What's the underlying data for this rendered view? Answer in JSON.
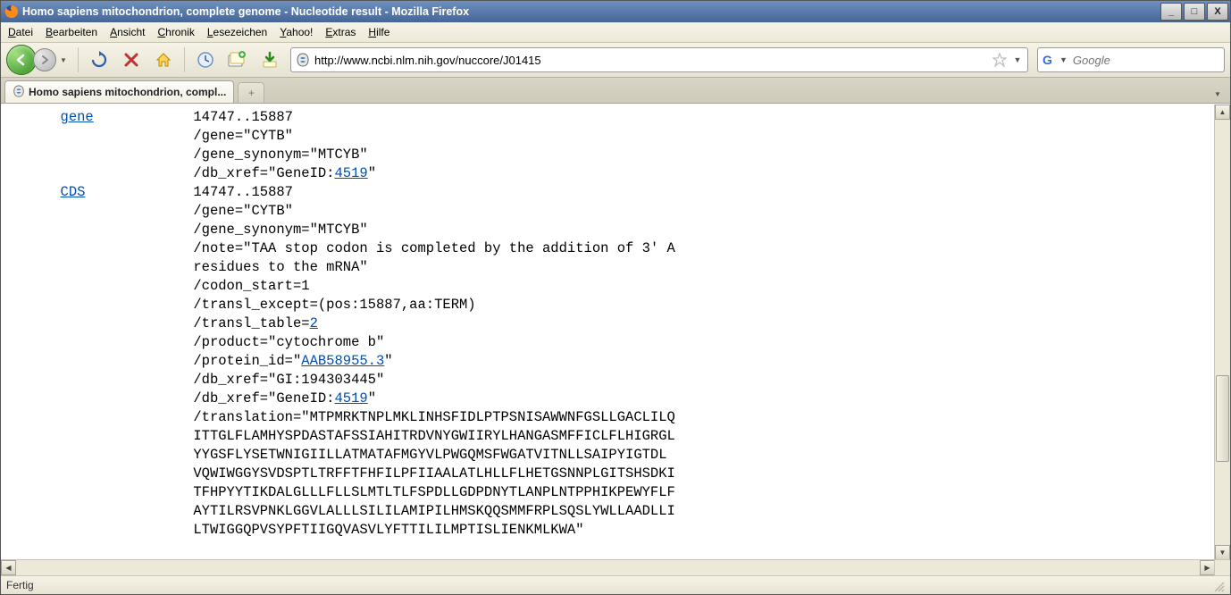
{
  "window": {
    "title": "Homo sapiens mitochondrion, complete genome - Nucleotide result - Mozilla Firefox"
  },
  "menu": {
    "items": [
      "Datei",
      "Bearbeiten",
      "Ansicht",
      "Chronik",
      "Lesezeichen",
      "Yahoo!",
      "Extras",
      "Hilfe"
    ]
  },
  "toolbar": {
    "url": "http://www.ncbi.nlm.nih.gov/nuccore/J01415",
    "search_placeholder": "Google"
  },
  "tabs": {
    "active": "Homo sapiens mitochondrion, compl..."
  },
  "status": {
    "text": "Fertig"
  },
  "content": {
    "lead_spaces": "     ",
    "data_spaces": "            ",
    "gene_key": "gene",
    "cds_key": "CDS",
    "gene": {
      "loc": "14747..15887",
      "q_gene": "/gene=\"CYTB\"",
      "q_syn": "/gene_synonym=\"MTCYB\"",
      "q_dbx_pre": "/db_xref=\"GeneID:",
      "q_dbx_link": "4519",
      "q_dbx_post": "\""
    },
    "cds": {
      "loc": "14747..15887",
      "q_gene": "/gene=\"CYTB\"",
      "q_syn": "/gene_synonym=\"MTCYB\"",
      "q_note1": "/note=\"TAA stop codon is completed by the addition of 3' A",
      "q_note2": "residues to the mRNA\"",
      "q_codon": "/codon_start=1",
      "q_texcept": "/transl_except=(pos:15887,aa:TERM)",
      "q_ttable_pre": "/transl_table=",
      "q_ttable_link": "2",
      "q_product": "/product=\"cytochrome b\"",
      "q_pid_pre": "/protein_id=\"",
      "q_pid_link": "AAB58955.3",
      "q_pid_post": "\"",
      "q_gi": "/db_xref=\"GI:194303445\"",
      "q_dbx2_pre": "/db_xref=\"GeneID:",
      "q_dbx2_link": "4519",
      "q_dbx2_post": "\"",
      "trans1": "/translation=\"MTPMRKTNPLMKLINHSFIDLPTPSNISAWWNFGSLLGACLILQ",
      "trans2": "ITTGLFLAMHYSPDASTAFSSIAHITRDVNYGWIIRYLHANGASMFFICLFLHIGRGL",
      "trans3": "YYGSFLYSETWNIGIILLATMATAFMGYVLPWGQMSFWGATVITNLLSAIPYIGTDL",
      "trans4": "VQWIWGGYSVDSPTLTRFFTFHFILPFIIAALATLHLLFLHETGSNNPLGITSHSDKI",
      "trans5": "TFHPYYTIKDALGLLLFLLSLMTLTLFSPDLLGDPDNYTLANPLNTPPHIKPEWYFLF",
      "trans6": "AYTILRSVPNKLGGVLALLLSILILAMIPILHMSKQQSMMFRPLSQSLYWLLAADLLI",
      "trans7": "LTWIGGQPVSYPFTIIGQVASVLYFTTILILMPTISLIENKMLKWA\""
    }
  }
}
